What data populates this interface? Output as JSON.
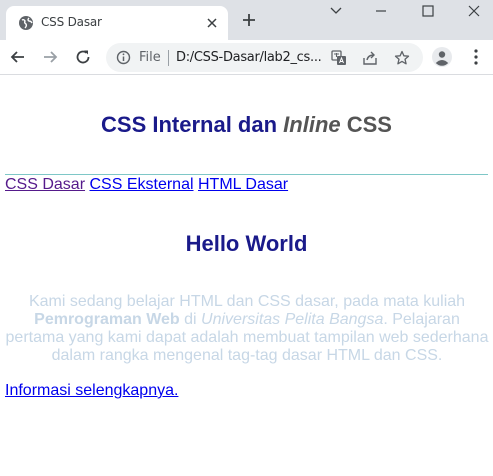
{
  "browser": {
    "tab_title": "CSS Dasar",
    "scheme_label": "File",
    "url": "D:/CSS-Dasar/lab2_cs...",
    "icons": [
      "globe-icon",
      "close-icon",
      "plus-icon",
      "chevron-down-icon",
      "minimize-icon",
      "maximize-icon",
      "window-close-icon",
      "back-arrow-icon",
      "forward-arrow-icon",
      "reload-icon",
      "info-icon",
      "translate-icon",
      "share-icon",
      "star-icon",
      "profile-icon",
      "kebab-menu-icon"
    ]
  },
  "page": {
    "title_prefix": "CSS Internal dan ",
    "title_italic": "Inline",
    "title_suffix": " CSS",
    "nav_links": [
      "CSS Dasar",
      "CSS Eksternal",
      "HTML Dasar"
    ],
    "heading": "Hello World",
    "paragraph": {
      "part1": "Kami sedang belajar HTML dan CSS dasar, pada mata kuliah ",
      "bold": "Pemrograman Web",
      "part2": " di ",
      "italic": "Universitas Pelita Bangsa",
      "part3": ". Pelajaran pertama yang kami dapat adalah membuat tampilan web sederhana dalam rangka mengenal tag-tag dasar HTML dan CSS."
    },
    "more_link": "Informasi selengkapnya."
  },
  "colors": {
    "heading": "#1a1a8a",
    "link": "#0000ee",
    "visited_link": "#551a8b",
    "paragraph": "#c7d7e6",
    "hr": "#7ec7c7"
  }
}
